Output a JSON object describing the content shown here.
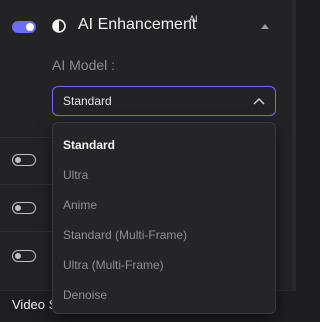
{
  "header": {
    "title": "AI Enhancement",
    "title_superscript": "AI",
    "toggle_state": "on",
    "icons": {
      "toggle": "toggle-switch",
      "feature": "contrast-icon",
      "collapse": "triangle-up-icon"
    }
  },
  "ai_model": {
    "label": "AI Model :",
    "selected": "Standard",
    "options": [
      "Standard",
      "Ultra",
      "Anime",
      "Standard (Multi-Frame)",
      "Ultra (Multi-Frame)",
      "Denoise"
    ]
  },
  "other_toggles": [
    {
      "state": "off"
    },
    {
      "state": "off"
    },
    {
      "state": "off"
    }
  ],
  "footer": {
    "section_title_partial": "Video S"
  },
  "colors": {
    "accent": "#6b6df2",
    "panel": "#232326",
    "text": "#e6e6ea",
    "muted_text": "#8e8e94"
  }
}
